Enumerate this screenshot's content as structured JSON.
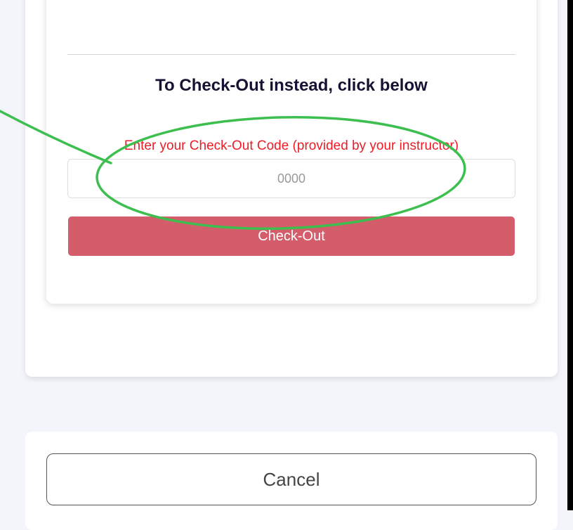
{
  "checkout": {
    "title": "To Check-Out instead, click below",
    "code_label": "Enter your Check-Out Code (provided by your instructor)",
    "code_placeholder": "0000",
    "code_value": "",
    "button_label": "Check-Out"
  },
  "footer": {
    "cancel_label": "Cancel"
  },
  "colors": {
    "page_background": "#f3f5fb",
    "title_text": "#161233",
    "label_text": "#ee1c25",
    "checkout_button": "#d45d6b",
    "annotation_green": "#3dbf4f"
  },
  "annotation": {
    "shapes": [
      "ellipse",
      "arrow-line"
    ]
  }
}
